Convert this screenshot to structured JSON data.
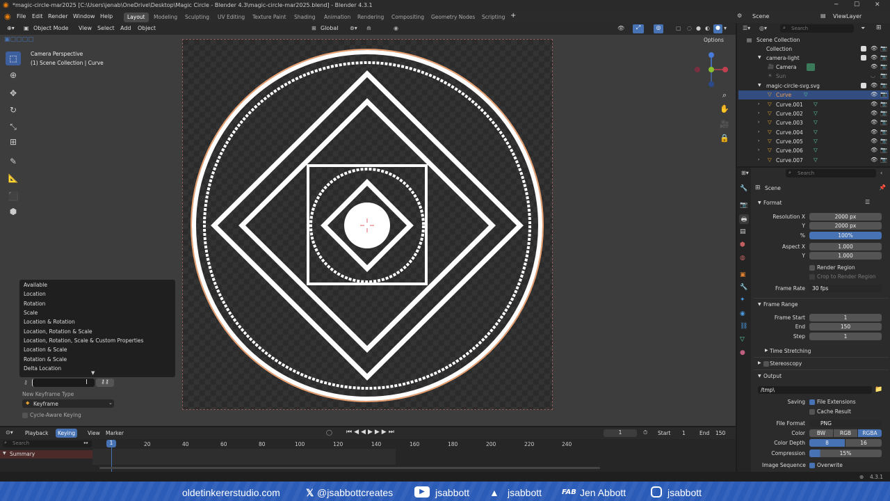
{
  "window": {
    "title": "*magic-circle-mar2025 [C:\\Users\\jenab\\OneDrive\\Desktop\\Magic Circle - Blender 4.3\\magic-circle-mar2025.blend] - Blender 4.3.1"
  },
  "menu": [
    "File",
    "Edit",
    "Render",
    "Window",
    "Help"
  ],
  "workspaces": [
    "Layout",
    "Modeling",
    "Sculpting",
    "UV Editing",
    "Texture Paint",
    "Shading",
    "Animation",
    "Rendering",
    "Compositing",
    "Geometry Nodes",
    "Scripting"
  ],
  "scene": {
    "name": "Scene",
    "view_layer": "ViewLayer"
  },
  "viewport_header": {
    "mode": "Object Mode",
    "view": "View",
    "select": "Select",
    "add": "Add",
    "object": "Object",
    "orientation": "Global",
    "options": "Options"
  },
  "viewport": {
    "camera_label": "Camera Perspective",
    "collection_label": "(1) Scene Collection | Curve"
  },
  "keying_popup": {
    "items": [
      "Available",
      "Location",
      "Rotation",
      "Scale",
      "Location & Rotation",
      "Location, Rotation & Scale",
      "Location, Rotation, Scale & Custom Properties",
      "Location & Scale",
      "Rotation & Scale",
      "Delta Location"
    ],
    "new_keyframe_type_label": "New Keyframe Type",
    "keyframe_type": "Keyframe",
    "cycle_aware": "Cycle-Aware Keying"
  },
  "timeline_header": {
    "editor": "Playback",
    "keying": "Keying",
    "view": "View",
    "marker": "Marker",
    "current_frame": "1",
    "start_label": "Start",
    "start": "1",
    "end_label": "End",
    "end": "150"
  },
  "timeline": {
    "search_placeholder": "Search",
    "summary": "Summary",
    "ticks": [
      "1",
      "20",
      "40",
      "60",
      "80",
      "100",
      "120",
      "140",
      "160",
      "180",
      "200",
      "220",
      "240"
    ]
  },
  "outliner": {
    "search_placeholder": "Search",
    "rows": [
      "Scene Collection",
      "Collection",
      "camera-light",
      "Camera",
      "Sun",
      "magic-circle-svg.svg",
      "Curve",
      "Curve.001",
      "Curve.002",
      "Curve.003",
      "Curve.004",
      "Curve.005",
      "Curve.006",
      "Curve.007"
    ]
  },
  "properties": {
    "search_placeholder": "Search",
    "scene": "Scene",
    "format": {
      "title": "Format",
      "res_x_label": "Resolution X",
      "res_x": "2000 px",
      "res_y_label": "Y",
      "res_y": "2000 px",
      "pct_label": "%",
      "pct": "100%",
      "aspect_x_label": "Aspect X",
      "aspect_x": "1.000",
      "aspect_y_label": "Y",
      "aspect_y": "1.000",
      "render_region": "Render Region",
      "crop": "Crop to Render Region",
      "frame_rate_label": "Frame Rate",
      "frame_rate": "30 fps"
    },
    "frame_range": {
      "title": "Frame Range",
      "start_label": "Frame Start",
      "start": "1",
      "end_label": "End",
      "end": "150",
      "step_label": "Step",
      "step": "1"
    },
    "time_stretching": "Time Stretching",
    "stereoscopy": "Stereoscopy",
    "output": {
      "title": "Output",
      "path": "/tmp\\",
      "saving_label": "Saving",
      "file_ext": "File Extensions",
      "cache": "Cache Result",
      "file_format_label": "File Format",
      "file_format": "PNG",
      "color_label": "Color",
      "bw": "BW",
      "rgb": "RGB",
      "rgba": "RGBA",
      "depth_label": "Color Depth",
      "depth_8": "8",
      "depth_16": "16",
      "compression_label": "Compression",
      "compression": "15%",
      "image_seq_label": "Image Sequence",
      "overwrite": "Overwrite"
    }
  },
  "status": {
    "version": "4.3.1"
  },
  "banner": {
    "site": "oldetinkererstudio.com",
    "x": "@jsabbottcreates",
    "youtube": "jsabbott",
    "threads": "jsabbott",
    "name": "Jen Abbott",
    "instagram": "jsabbott"
  }
}
